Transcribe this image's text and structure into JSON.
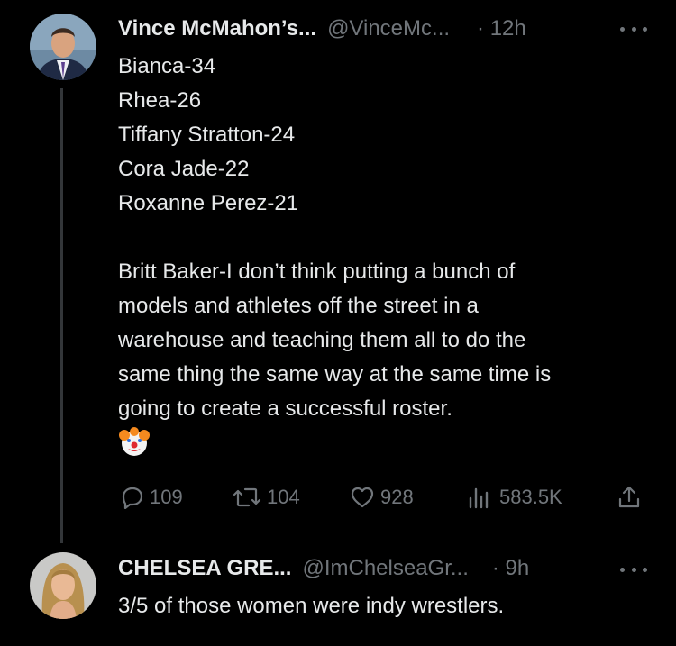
{
  "tweet1": {
    "display_name": "Vince McMahon’s...",
    "handle": "@VinceMc...",
    "time": "· 12h",
    "lines": [
      "Bianca-34",
      "Rhea-26",
      "Tiffany Stratton-24",
      "Cora Jade-22",
      "Roxanne Perez-21",
      "",
      "Britt Baker-I don’t think putting a bunch of",
      "models and athletes off the street in a",
      "warehouse and teaching them all to do the",
      "same thing the same way at the same time is",
      "going to create a successful roster."
    ],
    "emoji": "clown-face-emoji",
    "stats": {
      "replies": "109",
      "reposts": "104",
      "likes": "928",
      "views": "583.5K"
    }
  },
  "tweet2": {
    "display_name": "CHELSEA GRE...",
    "handle": "@ImChelseaGr...",
    "time": "· 9h",
    "text": "3/5 of those women were indy wrestlers."
  },
  "colors": {
    "background": "#000000",
    "text": "#e7e9ea",
    "secondary": "#71767b",
    "thread_line": "#333639"
  }
}
